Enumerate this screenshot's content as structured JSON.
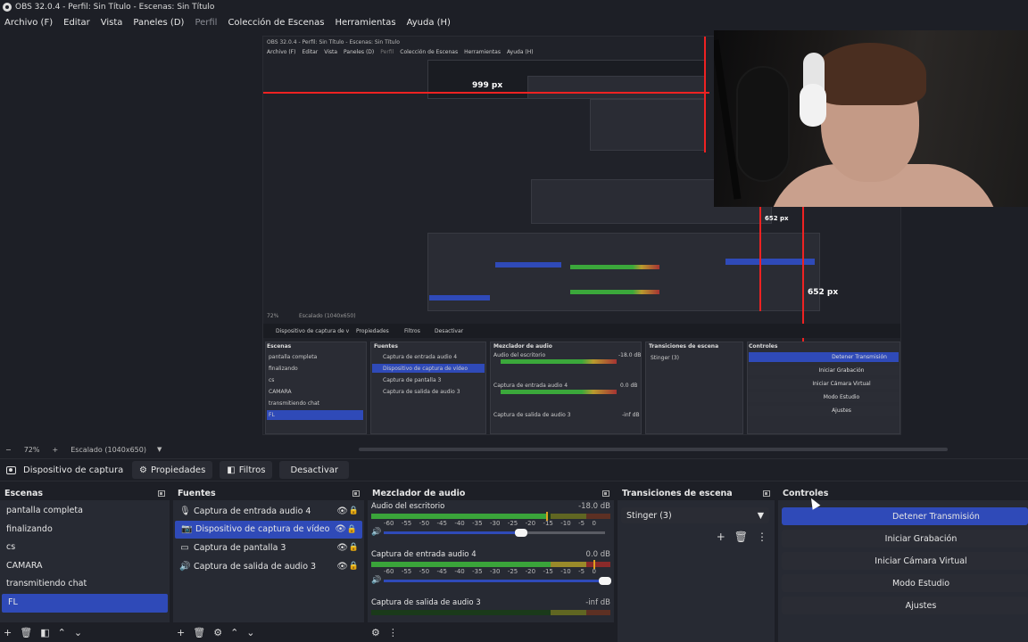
{
  "window": {
    "title": "OBS 32.0.4 - Perfil: Sin Título - Escenas: Sin Título"
  },
  "menu": [
    {
      "label": "Archivo (F)",
      "disabled": false
    },
    {
      "label": "Editar",
      "disabled": false
    },
    {
      "label": "Vista",
      "disabled": false
    },
    {
      "label": "Paneles (D)",
      "disabled": false
    },
    {
      "label": "Perfil",
      "disabled": true
    },
    {
      "label": "Colección de Escenas",
      "disabled": false
    },
    {
      "label": "Herramientas",
      "disabled": false
    },
    {
      "label": "Ayuda (H)",
      "disabled": false
    }
  ],
  "preview": {
    "nested": {
      "title": "OBS 32.0.4 - Perfil: Sin Título - Escenas: Sin Título",
      "menu": [
        "Archivo (F)",
        "Editar",
        "Vista",
        "Paneles (D)",
        "Perfil",
        "Colección de Escenas",
        "Herramientas",
        "Ayuda (H)"
      ],
      "measure_999": "999 px",
      "measure_652_a": "652 px",
      "measure_652_b": "652 px",
      "zoom": "72%",
      "scaled": "Escalado (1040x650)",
      "source_name": "Dispositivo de captura de v",
      "btn_properties": "Propiedades",
      "btn_filters": "Filtros",
      "btn_deactivate": "Desactivar",
      "panel_scenes": "Escenas",
      "panel_sources": "Fuentes",
      "panel_mixer": "Mezclador de audio",
      "panel_transitions": "Transiciones de escena",
      "panel_controls": "Controles",
      "scenes": [
        "pantalla completa",
        "finalizando",
        "cs",
        "CAMARA",
        "transmitiendo chat",
        "FL"
      ],
      "sources": [
        "Captura de entrada audio 4",
        "Dispositivo de captura de vídeo",
        "Captura de pantalla 3",
        "Captura de salida de audio 3"
      ],
      "mixer": [
        "Audio del escritorio",
        "Captura de entrada audio 4",
        "Captura de salida de audio 3"
      ],
      "mixer_db": [
        "-18.0 dB",
        "0.0 dB",
        "-inf dB"
      ],
      "transition": "Stinger (3)",
      "controls": [
        "Detener Transmisión",
        "Iniciar Grabación",
        "Iniciar Cámara Virtual",
        "Modo Estudio",
        "Ajustes"
      ]
    }
  },
  "scalebar": {
    "minus": "−",
    "zoom": "72%",
    "plus": "+",
    "scaled": "Escalado (1040x650)",
    "caret": "▼"
  },
  "source_toolbar": {
    "source_name": "Dispositivo de captura de v",
    "properties": "Propiedades",
    "filters": "Filtros",
    "deactivate": "Desactivar"
  },
  "scenes": {
    "title": "Escenas",
    "items": [
      {
        "label": "pantalla completa"
      },
      {
        "label": "finalizando"
      },
      {
        "label": "cs"
      },
      {
        "label": "CAMARA"
      },
      {
        "label": "transmitiendo chat"
      },
      {
        "label": "FL",
        "selected": true
      }
    ]
  },
  "sources": {
    "title": "Fuentes",
    "items": [
      {
        "label": "Captura de entrada audio 4",
        "icon": "microphone-icon"
      },
      {
        "label": "Dispositivo de captura de vídeo",
        "icon": "camera-icon",
        "selected": true
      },
      {
        "label": "Captura de pantalla 3",
        "icon": "monitor-icon"
      },
      {
        "label": "Captura de salida de audio 3",
        "icon": "speaker-icon"
      }
    ]
  },
  "mixer": {
    "title": "Mezclador de audio",
    "ticks": [
      "-60",
      "-55",
      "-50",
      "-45",
      "-40",
      "-35",
      "-30",
      "-25",
      "-20",
      "-15",
      "-10",
      "-5",
      "0"
    ],
    "channels": [
      {
        "name": "Audio del escritorio",
        "db": "-18.0 dB",
        "level": 0.73,
        "fader": 0.62
      },
      {
        "name": "Captura de entrada audio 4",
        "db": "0.0 dB",
        "level": 0.93,
        "fader": 1.0
      },
      {
        "name": "Captura de salida de audio 3",
        "db": "-inf dB",
        "level": 0.0,
        "fader": 1.0
      }
    ]
  },
  "transitions": {
    "title": "Transiciones de escena",
    "selected": "Stinger (3)"
  },
  "controls": {
    "title": "Controles",
    "buttons": [
      {
        "label": "Detener Transmisión",
        "active": true
      },
      {
        "label": "Iniciar Grabación"
      },
      {
        "label": "Iniciar Cámara Virtual"
      },
      {
        "label": "Modo Estudio"
      },
      {
        "label": "Ajustes"
      }
    ]
  },
  "colors": {
    "accent": "#2f4ab8",
    "panel_bg": "#272a33",
    "window_bg": "#1d1f26",
    "measure_line": "#ee2222"
  }
}
